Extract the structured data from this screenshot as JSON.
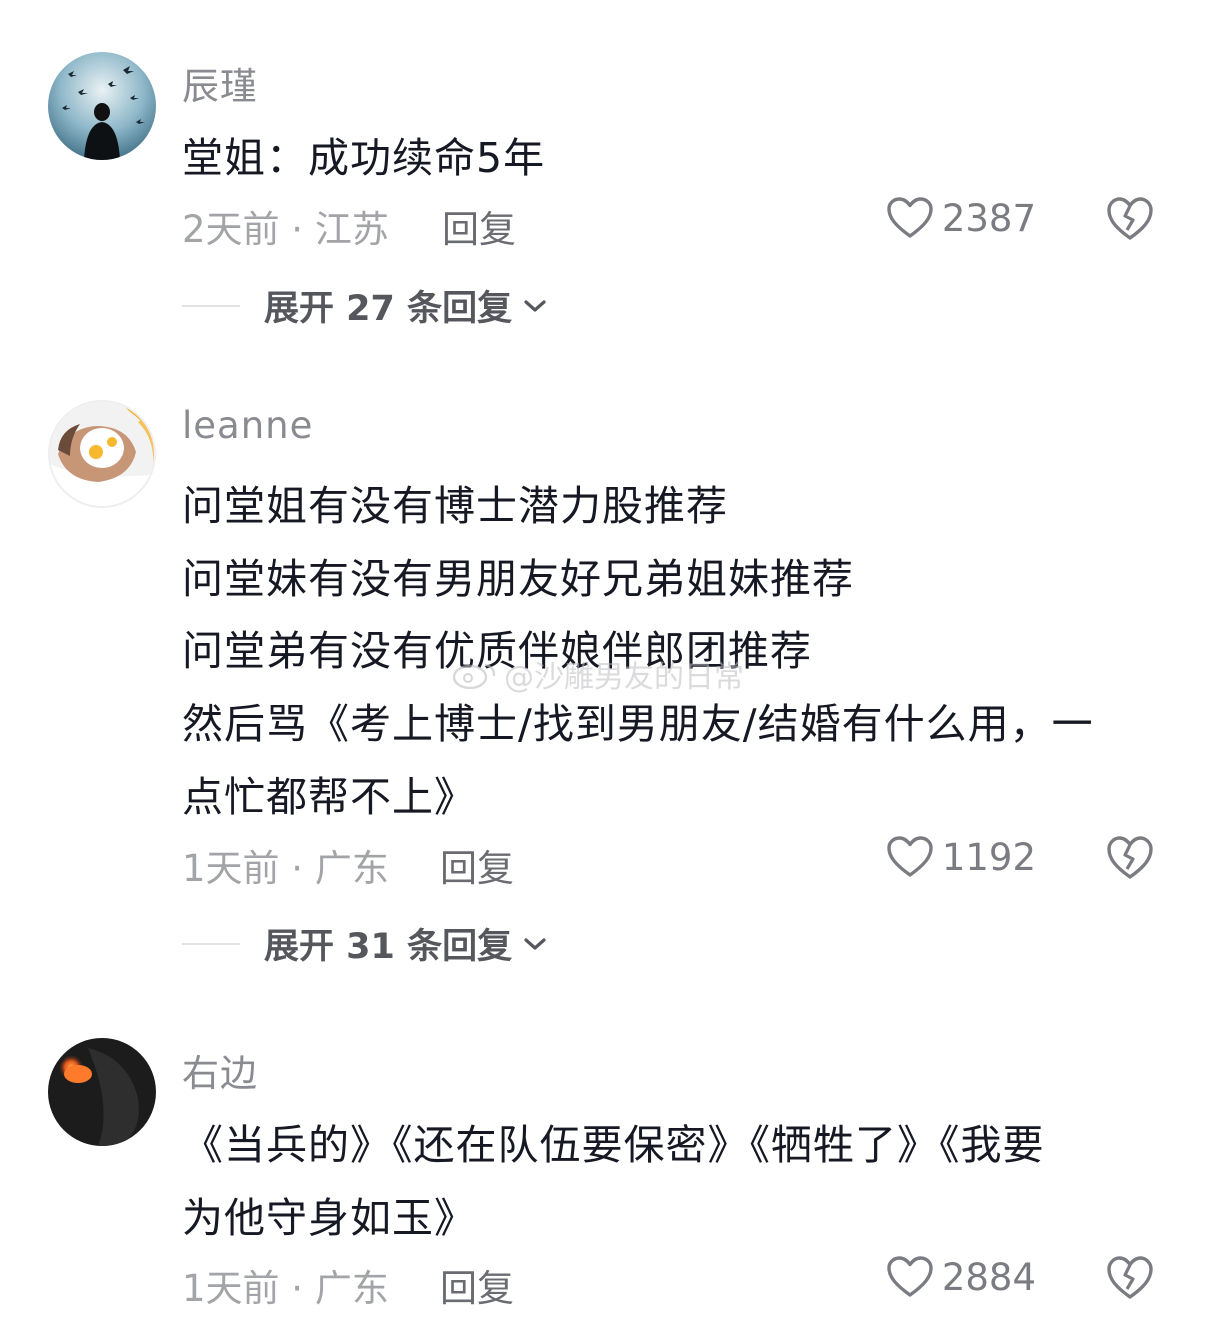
{
  "comments": [
    {
      "username": "辰瑾",
      "lines": [
        "堂姐：成功续命5年"
      ],
      "time_location": "2天前 · 江苏",
      "reply_label": "回复",
      "likes": "2387",
      "expand_label": "展开 27 条回复",
      "avatar_icon": "avatar-birds-silhouette"
    },
    {
      "username": "leanne",
      "lines": [
        "问堂姐有没有博士潜力股推荐",
        "问堂妹有没有男朋友好兄弟姐妹推荐",
        "问堂弟有没有优质伴娘伴郎团推荐",
        "然后骂《考上博士/找到男朋友/结婚有什么用，一",
        "点忙都帮不上》"
      ],
      "time_location": "1天前 · 广东",
      "reply_label": "回复",
      "likes": "1192",
      "expand_label": "展开 31 条回复",
      "avatar_icon": "avatar-egg-face-mask"
    },
    {
      "username": "右边",
      "lines": [
        "《当兵的》《还在队伍要保密》《牺牲了》《我要",
        "为他守身如玉》"
      ],
      "time_location": "1天前 · 广东",
      "reply_label": "回复",
      "likes": "2884",
      "avatar_icon": "avatar-dark-glow"
    }
  ],
  "watermark": "@沙雕男友的日常",
  "icons": {
    "like": "heart-outline-icon",
    "dislike": "broken-heart-icon",
    "expand": "chevron-down-icon"
  }
}
